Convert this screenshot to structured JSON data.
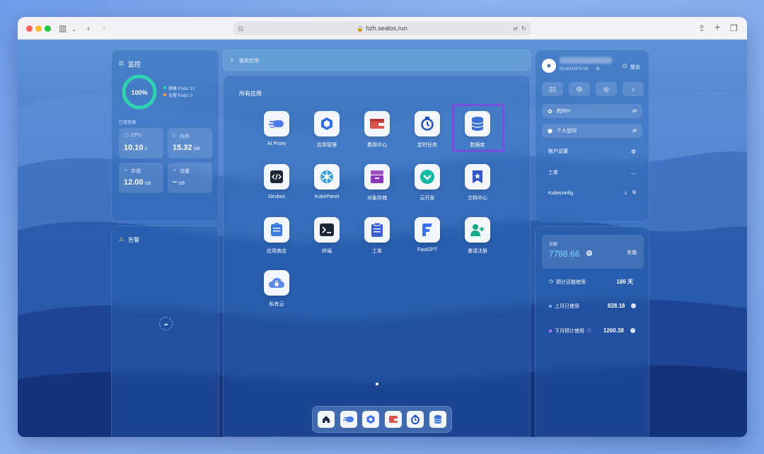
{
  "browser": {
    "url": "hzh.sealos.run"
  },
  "monitor": {
    "title": "监控",
    "percent": "100%",
    "healthy": "健康 Pods: 13",
    "alarm": "告警 Pods: 0",
    "used_resources": "已用资源",
    "cpu": {
      "label": "CPU",
      "value": "10.10",
      "unit": "C"
    },
    "memory": {
      "label": "内存",
      "value": "15.32",
      "unit": "GB"
    },
    "storage": {
      "label": "存储",
      "value": "12.00",
      "unit": "GB"
    },
    "traffic": {
      "label": "流量",
      "value": "~",
      "unit": "GB"
    }
  },
  "alerts": {
    "title": "告警"
  },
  "search": {
    "placeholder": "搜索应用"
  },
  "apps": {
    "title": "所有应用",
    "items": [
      {
        "name": "AI Proxy",
        "icon": "ai-proxy-icon"
      },
      {
        "name": "应用管理",
        "icon": "app-manage-icon"
      },
      {
        "name": "费用中心",
        "icon": "wallet-icon"
      },
      {
        "name": "定时任务",
        "icon": "timer-icon"
      },
      {
        "name": "数据库",
        "icon": "database-icon"
      },
      {
        "name": "Devbox",
        "icon": "devbox-icon"
      },
      {
        "name": "KubePanel",
        "icon": "kubepanel-icon"
      },
      {
        "name": "对象存储",
        "icon": "object-storage-icon"
      },
      {
        "name": "云开发",
        "icon": "cloud-dev-icon"
      },
      {
        "name": "文档中心",
        "icon": "docs-icon"
      },
      {
        "name": "应用商店",
        "icon": "app-store-icon"
      },
      {
        "name": "终端",
        "icon": "terminal-icon"
      },
      {
        "name": "工单",
        "icon": "ticket-icon"
      },
      {
        "name": "FastGPT",
        "icon": "fastgpt-icon"
      },
      {
        "name": "邀请注册",
        "icon": "invite-icon"
      },
      {
        "name": "私有云",
        "icon": "private-cloud-icon"
      }
    ]
  },
  "user": {
    "id": "ID:eIA1AF0-V8",
    "logout": "登出",
    "lang": "中",
    "region": "杭州H",
    "workspace": "个人空间",
    "account_settings": "账户设置",
    "tickets": "工单",
    "kubeconfig": "Kubeconfig"
  },
  "billing": {
    "balance_label": "余额",
    "balance": "7788.66",
    "recharge": "充值",
    "estimated_label": "预计还能使用",
    "estimated_value": "186 天",
    "last_month_label": "上月已使用",
    "last_month_value": "828.18",
    "next_month_label": "下月预计使用",
    "next_month_value": "1260.38"
  },
  "colors": {
    "highlight": "#7a4ce0",
    "ring": "#2fd1b0",
    "healthy_dot": "#2fd1b0",
    "alarm_dot": "#f29a4a"
  }
}
